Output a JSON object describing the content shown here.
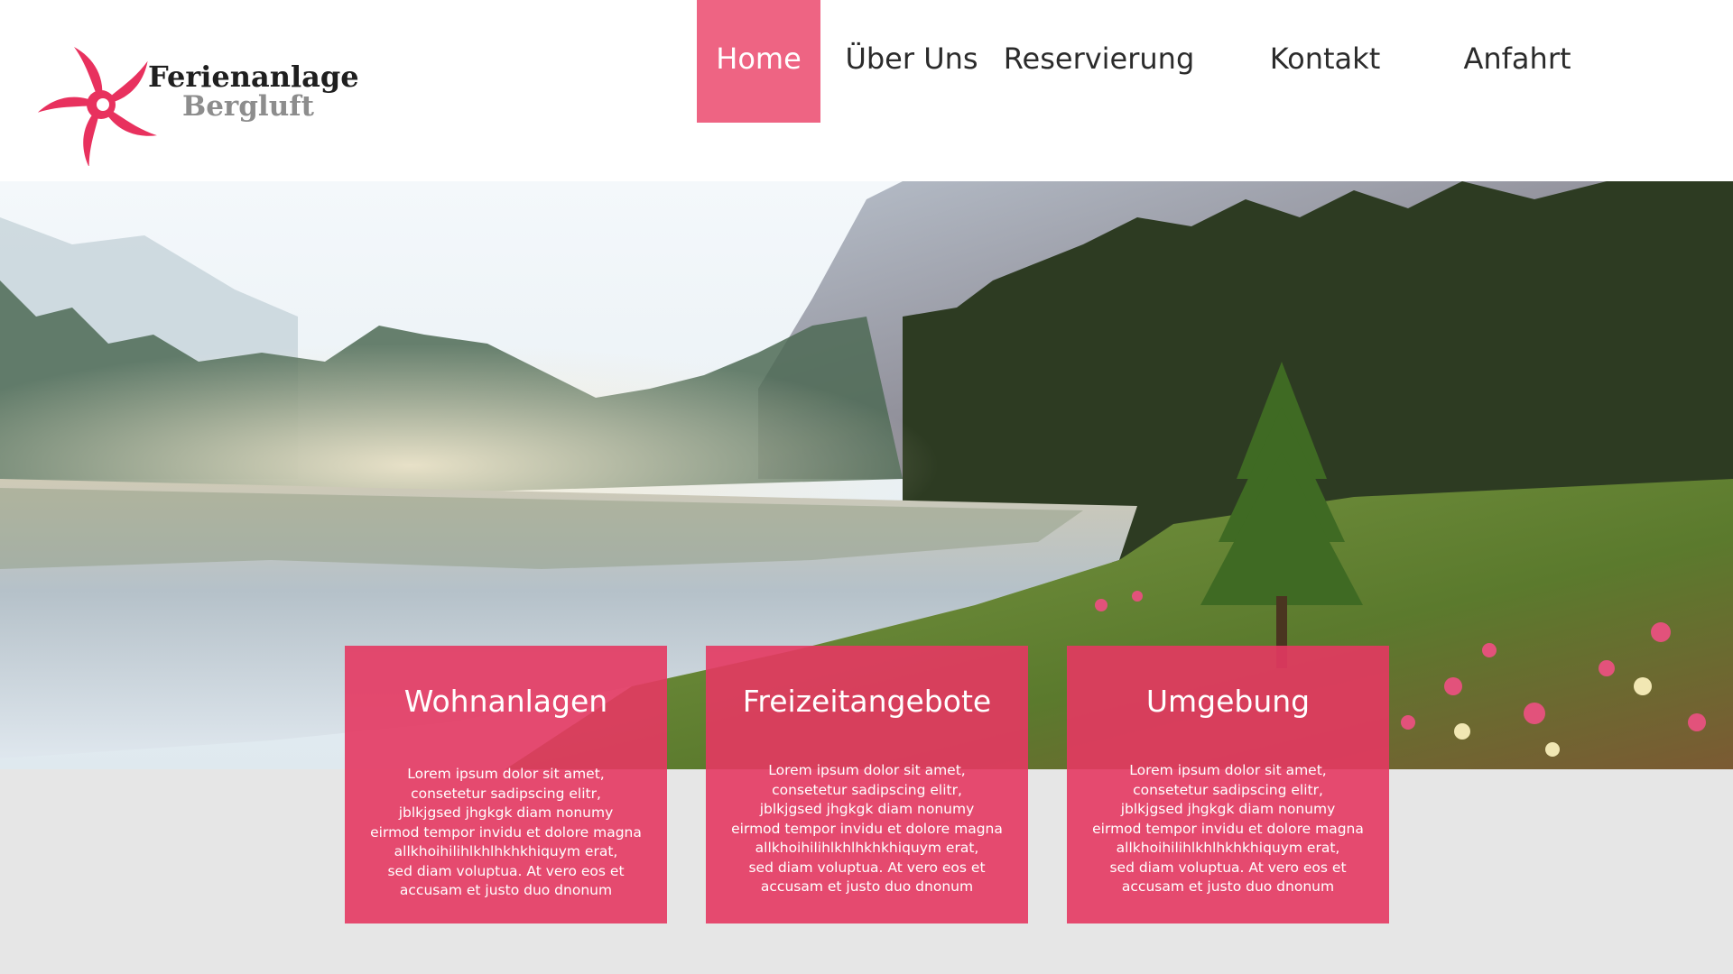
{
  "brand": {
    "title": "Ferienanlage",
    "subtitle": "Bergluft",
    "logo_icon": "flower-icon",
    "accent_color": "#ee6483",
    "card_color": "#e43862"
  },
  "nav": {
    "items": [
      {
        "label": "Home",
        "active": true
      },
      {
        "label": "Über Uns",
        "active": false
      },
      {
        "label": "Reservierung",
        "active": false
      },
      {
        "label": "Kontakt",
        "active": false
      },
      {
        "label": "Anfahrt",
        "active": false
      }
    ]
  },
  "cards": [
    {
      "title": "Wohnanlagen",
      "lines": [
        "Lorem ipsum dolor sit amet,",
        "consetetur sadipscing elitr,",
        "jblkjgsed jhgkgk diam nonumy",
        "eirmod tempor invidu et dolore magna",
        "allkhoihilihlkhlhkhkhiquym erat,",
        "sed diam voluptua. At vero eos et",
        "accusam et justo duo dnonum"
      ]
    },
    {
      "title": "Freizeitangebote",
      "lines": [
        "Lorem ipsum dolor sit amet,",
        "consetetur sadipscing elitr,",
        "jblkjgsed jhgkgk diam nonumy",
        "eirmod tempor invidu et dolore magna",
        "allkhoihilihlkhlhkhkhiquym erat,",
        "sed diam voluptua. At vero eos et",
        "accusam et justo duo dnonum"
      ]
    },
    {
      "title": "Umgebung",
      "lines": [
        "Lorem ipsum dolor sit amet,",
        "consetetur sadipscing elitr,",
        "jblkjgsed jhgkgk diam nonumy",
        "eirmod tempor invidu et dolore magna",
        "allkhoihilihlkhlhkhkhiquym erat,",
        "sed diam voluptua. At vero eos et",
        "accusam et justo duo dnonum"
      ]
    }
  ]
}
